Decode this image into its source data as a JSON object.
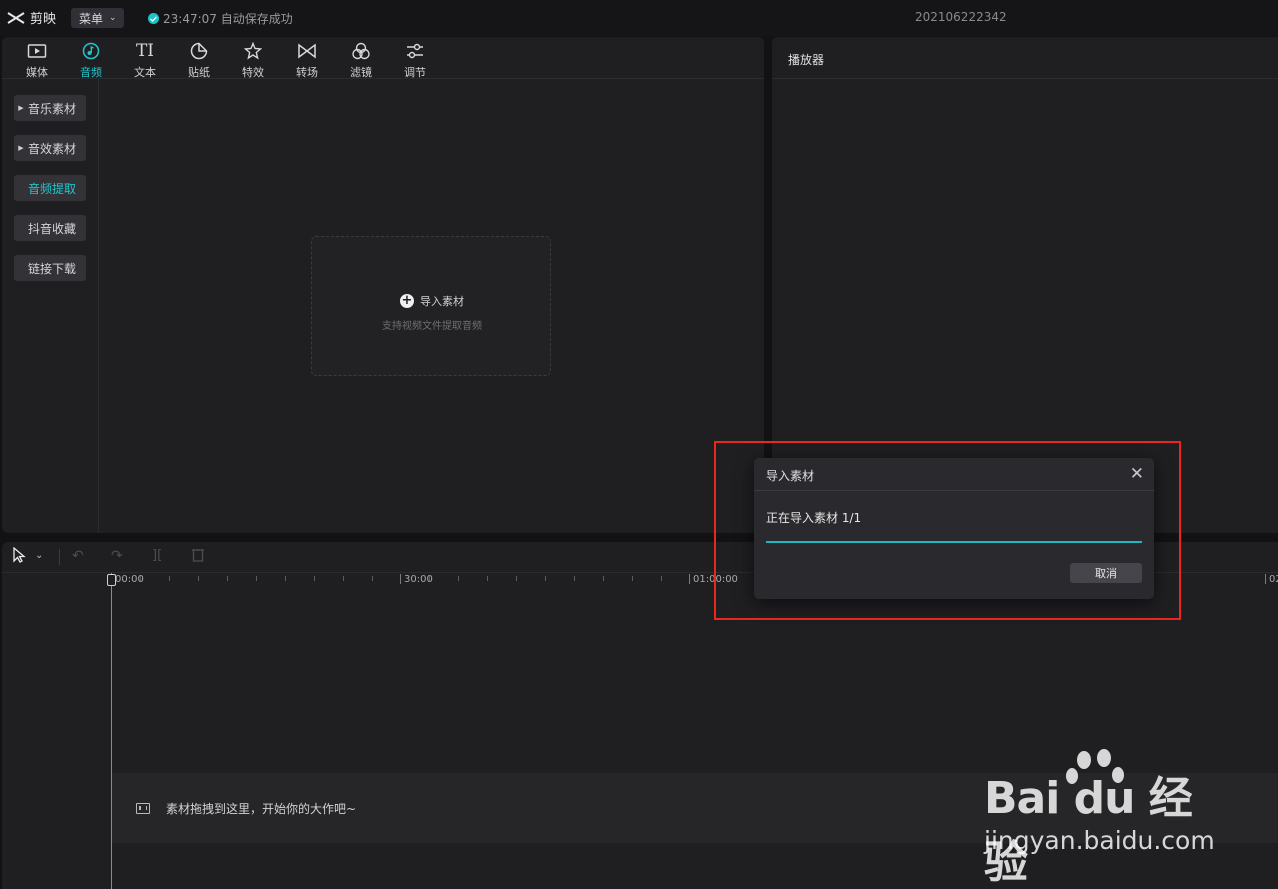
{
  "app": {
    "name": "剪映",
    "menu_label": "菜单",
    "autosave_text": "23:47:07 自动保存成功",
    "project_name": "202106222342"
  },
  "tabs": [
    {
      "label": "媒体",
      "icon": "media-icon"
    },
    {
      "label": "音频",
      "icon": "audio-icon",
      "active": true
    },
    {
      "label": "文本",
      "icon": "text-icon"
    },
    {
      "label": "贴纸",
      "icon": "sticker-icon"
    },
    {
      "label": "特效",
      "icon": "effects-icon"
    },
    {
      "label": "转场",
      "icon": "transition-icon"
    },
    {
      "label": "滤镜",
      "icon": "filter-icon"
    },
    {
      "label": "调节",
      "icon": "adjust-icon"
    }
  ],
  "sidebar": {
    "items": [
      {
        "label": "音乐素材",
        "arrow": true
      },
      {
        "label": "音效素材",
        "arrow": true
      },
      {
        "label": "音频提取",
        "active": true
      },
      {
        "label": "抖音收藏"
      },
      {
        "label": "链接下载"
      }
    ]
  },
  "import": {
    "title": "导入素材",
    "subtitle": "支持视频文件提取音频"
  },
  "player": {
    "title": "播放器"
  },
  "timeline": {
    "ticks": [
      "00:00",
      "30:00",
      "01:00:00",
      "02"
    ],
    "drop_hint": "素材拖拽到这里，开始你的大作吧~"
  },
  "dialog": {
    "title": "导入素材",
    "message": "正在导入素材 1/1",
    "progress": 1.0,
    "cancel_label": "取消"
  },
  "colors": {
    "accent": "#22c5cc",
    "highlight_box": "#e8281e",
    "background": "#121214",
    "panel": "#1f1f22"
  },
  "watermark": {
    "logo_text": "Bai du 经验",
    "url": "jingyan.baidu.com"
  }
}
